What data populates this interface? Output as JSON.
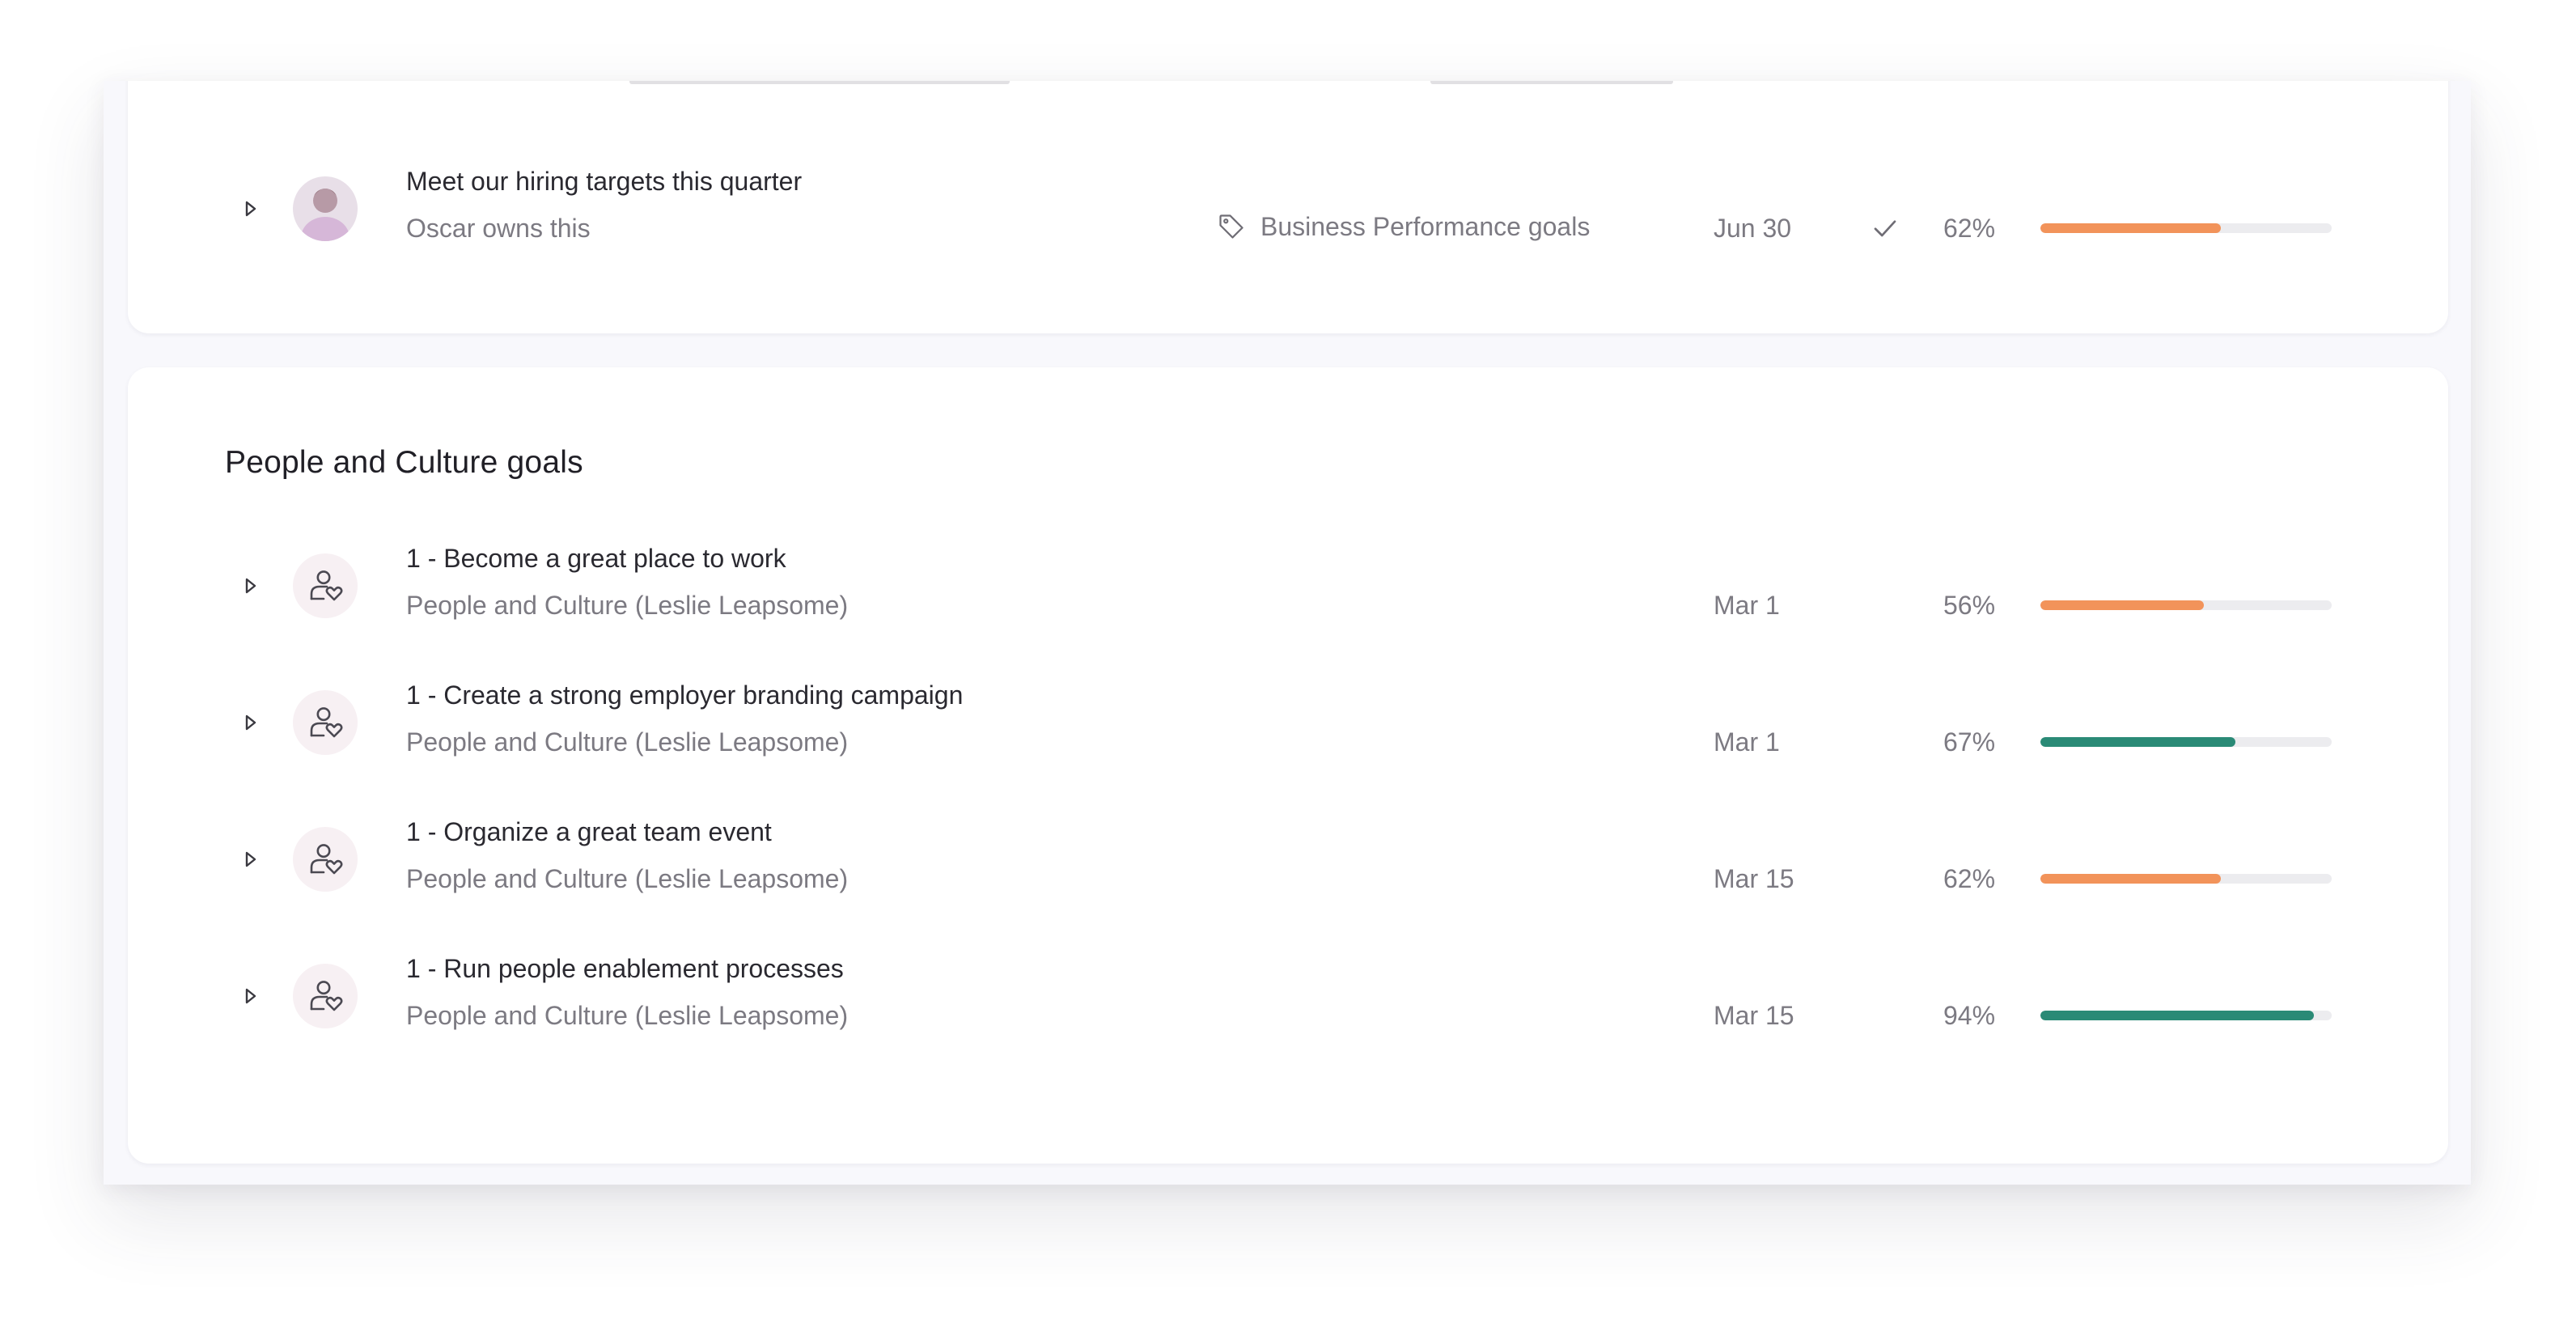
{
  "top_card": {
    "goal": {
      "title": "Meet our hiring targets this quarter",
      "owner": "Oscar owns this",
      "tag": "Business Performance goals",
      "tag_icon": "tag-icon",
      "due_date": "Jun 30",
      "status_icon": "check-icon",
      "progress_text": "62%",
      "progress": 0.62,
      "progress_color": "#f2935a",
      "avatar": "user-photo"
    }
  },
  "people_culture": {
    "title": "People and Culture goals",
    "goals": [
      {
        "title": "1 - Become a great place to work",
        "owner": "People and Culture (Leslie Leapsome)",
        "due_date": "Mar 1",
        "progress_text": "56%",
        "progress": 0.56,
        "progress_color": "#f2935a",
        "avatar_icon": "team-icon"
      },
      {
        "title": "1 - Create a strong employer branding campaign",
        "owner": "People and Culture (Leslie Leapsome)",
        "due_date": "Mar 1",
        "progress_text": "67%",
        "progress": 0.67,
        "progress_color": "#2a8a76",
        "avatar_icon": "team-icon"
      },
      {
        "title": "1 - Organize a great team event",
        "owner": "People and Culture (Leslie Leapsome)",
        "due_date": "Mar 15",
        "progress_text": "62%",
        "progress": 0.62,
        "progress_color": "#f2935a",
        "avatar_icon": "team-icon"
      },
      {
        "title": "1 - Run people enablement processes",
        "owner": "People and Culture (Leslie Leapsome)",
        "due_date": "Mar 15",
        "progress_text": "94%",
        "progress": 0.94,
        "progress_color": "#2a8a76",
        "avatar_icon": "team-icon"
      }
    ]
  },
  "colors": {
    "accent_orange": "#f2935a",
    "accent_green": "#2a8a76",
    "page_background": "#f8f8fc"
  },
  "icons": {
    "expand": "expand-triangle-icon",
    "tag": "tag-icon",
    "check": "check-icon",
    "team": "team-icon"
  }
}
